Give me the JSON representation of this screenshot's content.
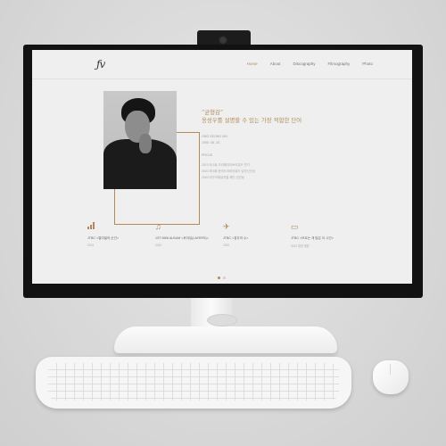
{
  "colors": {
    "accent": "#b08a5a",
    "bezel": "#121212",
    "screen_bg": "#efefef"
  },
  "site": {
    "nav": {
      "items": [
        "Home",
        "About",
        "Discography",
        "Filmography",
        "Photo"
      ],
      "active": "Home"
    },
    "hero": {
      "quote": "“균형감”",
      "subtitle": "옹성우를 설명할 수 있는 가장 적합한 단어",
      "name": "ONG SEONG WU",
      "birth": "1995. 08. 25.",
      "works_label": "PROJS",
      "works": [
        "2019 제 1회 크리에이티브어워드 연기",
        "2020 제 5회 한국드라마어워드 남자신인상",
        "2020 대구국제뮤지컬 재단 신인상"
      ]
    },
    "cards": [
      {
        "icon": "signal-bars-icon",
        "title": "JTBC <열여덟의 순간>",
        "sub": "2019"
      },
      {
        "icon": "music-note-icon",
        "title": "1ST MINI ALBUM <후아유(LAYERS)>",
        "sub": "2020"
      },
      {
        "icon": "airplane-icon",
        "title": "JTBC <경우의 수>",
        "sub": "2020"
      },
      {
        "icon": "chat-icon",
        "title": "JTBC <모르는 게 많은 이 시간>",
        "sub": "2022 방영 예정"
      }
    ],
    "pagination": {
      "count": 2,
      "active": 0
    }
  }
}
